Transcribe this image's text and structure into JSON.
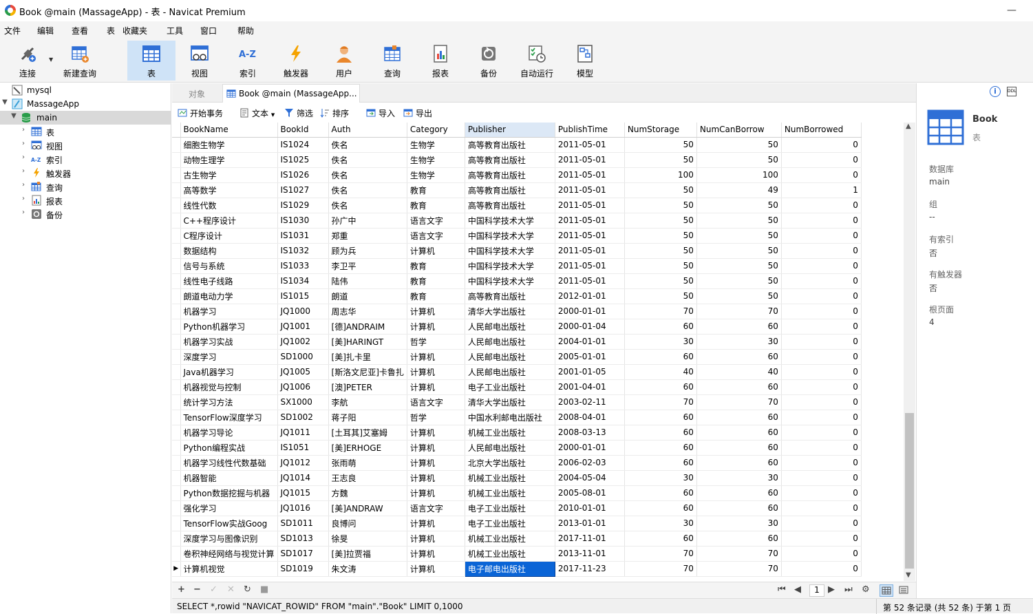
{
  "window": {
    "title": "Book @main (MassageApp) - 表 - Navicat Premium",
    "minimize": "—"
  },
  "menu": [
    "文件",
    "编辑",
    "查看",
    "表",
    "收藏夹",
    "工具",
    "窗口",
    "帮助"
  ],
  "toolbar": [
    {
      "label": "连接",
      "icon": "plug-icon"
    },
    {
      "label": "新建查询",
      "icon": "new-query-icon"
    },
    {
      "label": "表",
      "icon": "table-icon",
      "active": true
    },
    {
      "label": "视图",
      "icon": "view-icon"
    },
    {
      "label": "索引",
      "icon": "index-icon"
    },
    {
      "label": "触发器",
      "icon": "trigger-icon"
    },
    {
      "label": "用户",
      "icon": "user-icon"
    },
    {
      "label": "查询",
      "icon": "query-icon"
    },
    {
      "label": "报表",
      "icon": "report-icon"
    },
    {
      "label": "备份",
      "icon": "backup-icon"
    },
    {
      "label": "自动运行",
      "icon": "automation-icon"
    },
    {
      "label": "模型",
      "icon": "model-icon"
    }
  ],
  "sidebar": {
    "items": [
      {
        "label": "mysql",
        "level": 0
      },
      {
        "label": "MassageApp",
        "level": 0
      },
      {
        "label": "main",
        "level": 1
      },
      {
        "label": "表",
        "level": 2
      },
      {
        "label": "视图",
        "level": 2
      },
      {
        "label": "索引",
        "level": 2
      },
      {
        "label": "触发器",
        "level": 2
      },
      {
        "label": "查询",
        "level": 2
      },
      {
        "label": "报表",
        "level": 2
      },
      {
        "label": "备份",
        "level": 2
      }
    ]
  },
  "tabs": {
    "objects": "对象",
    "book": "Book @main (MassageApp..."
  },
  "subtoolbar": {
    "begin": "开始事务",
    "text": "文本",
    "filter": "筛选",
    "sort": "排序",
    "import": "导入",
    "export": "导出"
  },
  "table": {
    "columns": [
      "BookName",
      "BookId",
      "Auth",
      "Category",
      "Publisher",
      "PublishTime",
      "NumStorage",
      "NumCanBorrow",
      "NumBorrowed"
    ],
    "rows": [
      [
        "细胞生物学",
        "IS1024",
        "佚名",
        "生物学",
        "高等教育出版社",
        "2011-05-01",
        "50",
        "50",
        "0"
      ],
      [
        "动物生理学",
        "IS1025",
        "佚名",
        "生物学",
        "高等教育出版社",
        "2011-05-01",
        "50",
        "50",
        "0"
      ],
      [
        "古生物学",
        "IS1026",
        "佚名",
        "生物学",
        "高等教育出版社",
        "2011-05-01",
        "100",
        "100",
        "0"
      ],
      [
        "高等数学",
        "IS1027",
        "佚名",
        "教育",
        "高等教育出版社",
        "2011-05-01",
        "50",
        "49",
        "1"
      ],
      [
        "线性代数",
        "IS1029",
        "佚名",
        "教育",
        "高等教育出版社",
        "2011-05-01",
        "50",
        "50",
        "0"
      ],
      [
        "C++程序设计",
        "IS1030",
        "孙广中",
        "语言文字",
        "中国科学技术大学",
        "2011-05-01",
        "50",
        "50",
        "0"
      ],
      [
        "C程序设计",
        "IS1031",
        "郑重",
        "语言文字",
        "中国科学技术大学",
        "2011-05-01",
        "50",
        "50",
        "0"
      ],
      [
        "数据结构",
        "IS1032",
        "顾为兵",
        "计算机",
        "中国科学技术大学",
        "2011-05-01",
        "50",
        "50",
        "0"
      ],
      [
        "信号与系统",
        "IS1033",
        "李卫平",
        "教育",
        "中国科学技术大学",
        "2011-05-01",
        "50",
        "50",
        "0"
      ],
      [
        "线性电子线路",
        "IS1034",
        "陆伟",
        "教育",
        "中国科学技术大学",
        "2011-05-01",
        "50",
        "50",
        "0"
      ],
      [
        "朗道电动力学",
        "IS1015",
        "朗道",
        "教育",
        "高等教育出版社",
        "2012-01-01",
        "50",
        "50",
        "0"
      ],
      [
        "机器学习",
        "JQ1000",
        "周志华",
        "计算机",
        "清华大学出版社",
        "2000-01-01",
        "70",
        "70",
        "0"
      ],
      [
        "Python机器学习",
        "JQ1001",
        "[德]ANDRAIM",
        "计算机",
        "人民邮电出版社",
        "2000-01-04",
        "60",
        "60",
        "0"
      ],
      [
        "机器学习实战",
        "JQ1002",
        "[美]HARINGT",
        "哲学",
        "人民邮电出版社",
        "2004-01-01",
        "30",
        "30",
        "0"
      ],
      [
        "深度学习",
        "SD1000",
        "[美]扎卡里",
        "计算机",
        "人民邮电出版社",
        "2005-01-01",
        "60",
        "60",
        "0"
      ],
      [
        "Java机器学习",
        "JQ1005",
        "[斯洛文尼亚]卡鲁扎",
        "计算机",
        "人民邮电出版社",
        "2001-01-05",
        "40",
        "40",
        "0"
      ],
      [
        "机器视觉与控制",
        "JQ1006",
        "[澳]PETER",
        "计算机",
        "电子工业出版社",
        "2001-04-01",
        "60",
        "60",
        "0"
      ],
      [
        "统计学习方法",
        "SX1000",
        "李航",
        "语言文字",
        "清华大学出版社",
        "2003-02-11",
        "70",
        "70",
        "0"
      ],
      [
        "TensorFlow深度学习",
        "SD1002",
        "蒋子阳",
        "哲学",
        "中国水利邮电出版社",
        "2008-04-01",
        "60",
        "60",
        "0"
      ],
      [
        "机器学习导论",
        "JQ1011",
        "[土耳其]艾塞姆",
        "计算机",
        "机械工业出版社",
        "2008-03-13",
        "60",
        "60",
        "0"
      ],
      [
        "Python编程实战",
        "IS1051",
        "[美]ERHOGE",
        "计算机",
        "人民邮电出版社",
        "2000-01-01",
        "60",
        "60",
        "0"
      ],
      [
        "机器学习线性代数基础",
        "JQ1012",
        "张雨萌",
        "计算机",
        "北京大学出版社",
        "2006-02-03",
        "60",
        "60",
        "0"
      ],
      [
        "机器智能",
        "JQ1014",
        "王志良",
        "计算机",
        "机械工业出版社",
        "2004-05-04",
        "30",
        "30",
        "0"
      ],
      [
        "Python数据挖掘与机器",
        "JQ1015",
        "方魏",
        "计算机",
        "机械工业出版社",
        "2005-08-01",
        "60",
        "60",
        "0"
      ],
      [
        "强化学习",
        "JQ1016",
        "[美]ANDRAW",
        "语言文字",
        "电子工业出版社",
        "2010-01-01",
        "60",
        "60",
        "0"
      ],
      [
        "TensorFlow实战Goog",
        "SD1011",
        "良博问",
        "计算机",
        "电子工业出版社",
        "2013-01-01",
        "30",
        "30",
        "0"
      ],
      [
        "深度学习与图像识别",
        "SD1013",
        "徐旻",
        "计算机",
        "机械工业出版社",
        "2017-11-01",
        "60",
        "60",
        "0"
      ],
      [
        "卷积神经网络与视觉计算",
        "SD1017",
        "[美]拉贾福",
        "计算机",
        "机械工业出版社",
        "2013-11-01",
        "70",
        "70",
        "0"
      ],
      [
        "计算机视觉",
        "SD1019",
        "朱文涛",
        "计算机",
        "电子邮电出版社",
        "2017-11-23",
        "70",
        "70",
        "0"
      ]
    ]
  },
  "pager": {
    "page": "1"
  },
  "status": {
    "sql": "SELECT *,rowid \"NAVICAT_ROWID\" FROM \"main\".\"Book\" LIMIT 0,1000",
    "records": "第 52 条记录 (共 52 条) 于第 1 页"
  },
  "info_panel": {
    "name": "Book",
    "type": "表",
    "fields": [
      {
        "label": "数据库",
        "value": "main"
      },
      {
        "label": "组",
        "value": "--"
      },
      {
        "label": "有索引",
        "value": "否"
      },
      {
        "label": "有触发器",
        "value": "否"
      },
      {
        "label": "根页面",
        "value": "4"
      }
    ]
  },
  "colors": {
    "accent": "#0a64d6",
    "toolbar_active": "#cfe3f7",
    "db_green": "#2a9d4a"
  }
}
